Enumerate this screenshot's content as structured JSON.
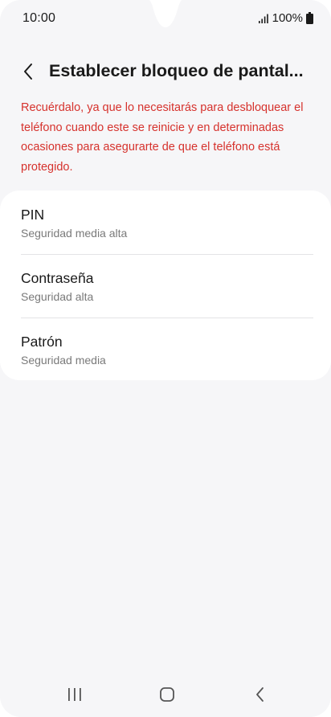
{
  "status_bar": {
    "time": "10:00",
    "battery_text": "100%",
    "signal_icon": "signal-icon",
    "battery_icon": "battery-icon"
  },
  "header": {
    "title": "Establecer bloqueo de pantal...",
    "back_icon": "chevron-left-icon"
  },
  "warning": {
    "text": "Recuérdalo, ya que lo necesitarás para desbloquear el teléfono cuando este se reinicie y en determinadas ocasiones para asegurarte de que el teléfono está protegido.",
    "color": "#d6322d"
  },
  "options": [
    {
      "title": "PIN",
      "subtitle": "Seguridad media alta"
    },
    {
      "title": "Contraseña",
      "subtitle": "Seguridad alta"
    },
    {
      "title": "Patrón",
      "subtitle": "Seguridad media"
    }
  ],
  "nav_bar": {
    "recents_icon": "recents-icon",
    "home_icon": "home-icon",
    "back_icon": "back-icon"
  }
}
